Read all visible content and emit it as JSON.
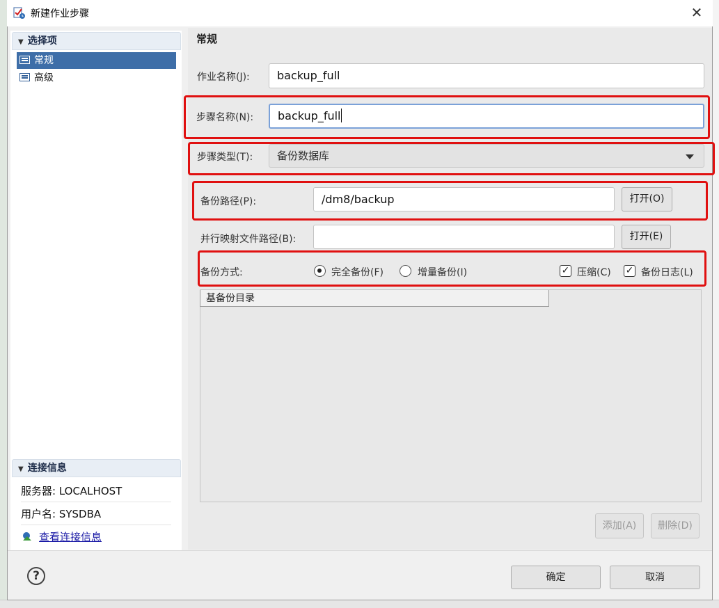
{
  "window": {
    "title": "新建作业步骤",
    "close_glyph": "✕"
  },
  "left": {
    "options_header": "选择项",
    "nav": [
      {
        "label": "常规"
      },
      {
        "label": "高级"
      }
    ],
    "conn_header": "连接信息",
    "server": "服务器: LOCALHOST",
    "user": "用户名: SYSDBA",
    "view_conn": "查看连接信息"
  },
  "form": {
    "title": "常规",
    "job_name_label": "作业名称(J):",
    "job_name_value": "backup_full",
    "step_name_label": "步骤名称(N):",
    "step_name_value": "backup_full",
    "step_type_label": "步骤类型(T):",
    "step_type_value": "备份数据库",
    "backup_path_label": "备份路径(P):",
    "backup_path_value": "/dm8/backup",
    "open_o": "打开(O)",
    "mapped_path_label": "并行映射文件路径(B):",
    "mapped_path_value": "",
    "open_e": "打开(E)",
    "backup_mode_label": "备份方式:",
    "full_backup": "完全备份(F)",
    "incr_backup": "增量备份(I)",
    "compress": "压缩(C)",
    "backup_log": "备份日志(L)",
    "base_dir_header": "基备份目录",
    "add": "添加(A)",
    "delete": "删除(D)"
  },
  "footer": {
    "ok": "确定",
    "cancel": "取消",
    "help_glyph": "?"
  },
  "colors": {
    "selection": "#3e6ea8",
    "highlight": "#e01010",
    "link": "#1a1aa6"
  }
}
